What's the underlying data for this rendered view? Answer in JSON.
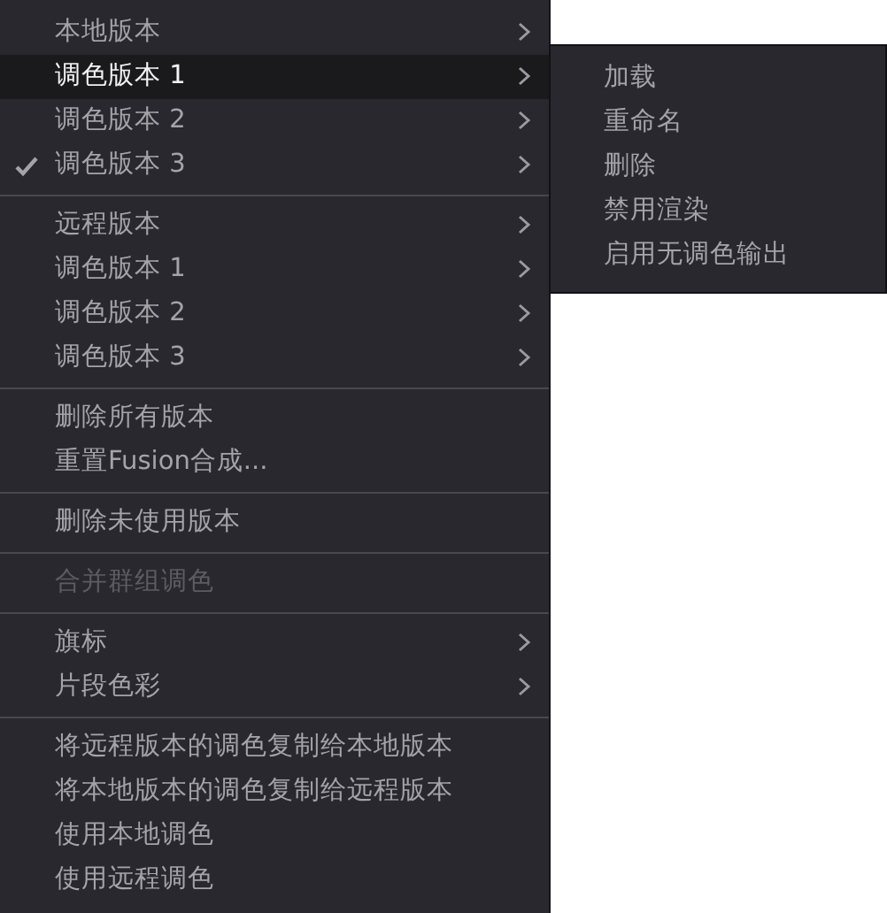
{
  "menu": {
    "sections": [
      {
        "items": [
          {
            "label": "本地版本",
            "kind": "submenu",
            "selected": false,
            "checked": false,
            "disabled": false
          },
          {
            "label": "调色版本 1",
            "kind": "submenu",
            "selected": true,
            "checked": false,
            "disabled": false
          },
          {
            "label": "调色版本 2",
            "kind": "submenu",
            "selected": false,
            "checked": false,
            "disabled": false
          },
          {
            "label": "调色版本 3",
            "kind": "submenu",
            "selected": false,
            "checked": true,
            "disabled": false
          }
        ]
      },
      {
        "items": [
          {
            "label": "远程版本",
            "kind": "submenu",
            "selected": false,
            "checked": false,
            "disabled": false
          },
          {
            "label": "调色版本 1",
            "kind": "submenu",
            "selected": false,
            "checked": false,
            "disabled": false
          },
          {
            "label": "调色版本 2",
            "kind": "submenu",
            "selected": false,
            "checked": false,
            "disabled": false
          },
          {
            "label": "调色版本 3",
            "kind": "submenu",
            "selected": false,
            "checked": false,
            "disabled": false
          }
        ]
      },
      {
        "items": [
          {
            "label": "删除所有版本",
            "kind": "action",
            "selected": false,
            "checked": false,
            "disabled": false
          },
          {
            "label": "重置Fusion合成...",
            "kind": "action",
            "selected": false,
            "checked": false,
            "disabled": false
          }
        ]
      },
      {
        "items": [
          {
            "label": "删除未使用版本",
            "kind": "action",
            "selected": false,
            "checked": false,
            "disabled": false
          }
        ]
      },
      {
        "items": [
          {
            "label": "合并群组调色",
            "kind": "action",
            "selected": false,
            "checked": false,
            "disabled": true
          }
        ]
      },
      {
        "items": [
          {
            "label": "旗标",
            "kind": "submenu",
            "selected": false,
            "checked": false,
            "disabled": false
          },
          {
            "label": "片段色彩",
            "kind": "submenu",
            "selected": false,
            "checked": false,
            "disabled": false
          }
        ]
      },
      {
        "items": [
          {
            "label": "将远程版本的调色复制给本地版本",
            "kind": "action",
            "selected": false,
            "checked": false,
            "disabled": false
          },
          {
            "label": "将本地版本的调色复制给远程版本",
            "kind": "action",
            "selected": false,
            "checked": false,
            "disabled": false
          },
          {
            "label": "使用本地调色",
            "kind": "action",
            "selected": false,
            "checked": false,
            "disabled": false
          },
          {
            "label": "使用远程调色",
            "kind": "action",
            "selected": false,
            "checked": false,
            "disabled": false
          }
        ]
      }
    ]
  },
  "submenu": {
    "items": [
      {
        "label": "加载"
      },
      {
        "label": "重命名"
      },
      {
        "label": "删除"
      },
      {
        "label": "禁用渲染"
      },
      {
        "label": "启用无调色输出"
      }
    ]
  }
}
